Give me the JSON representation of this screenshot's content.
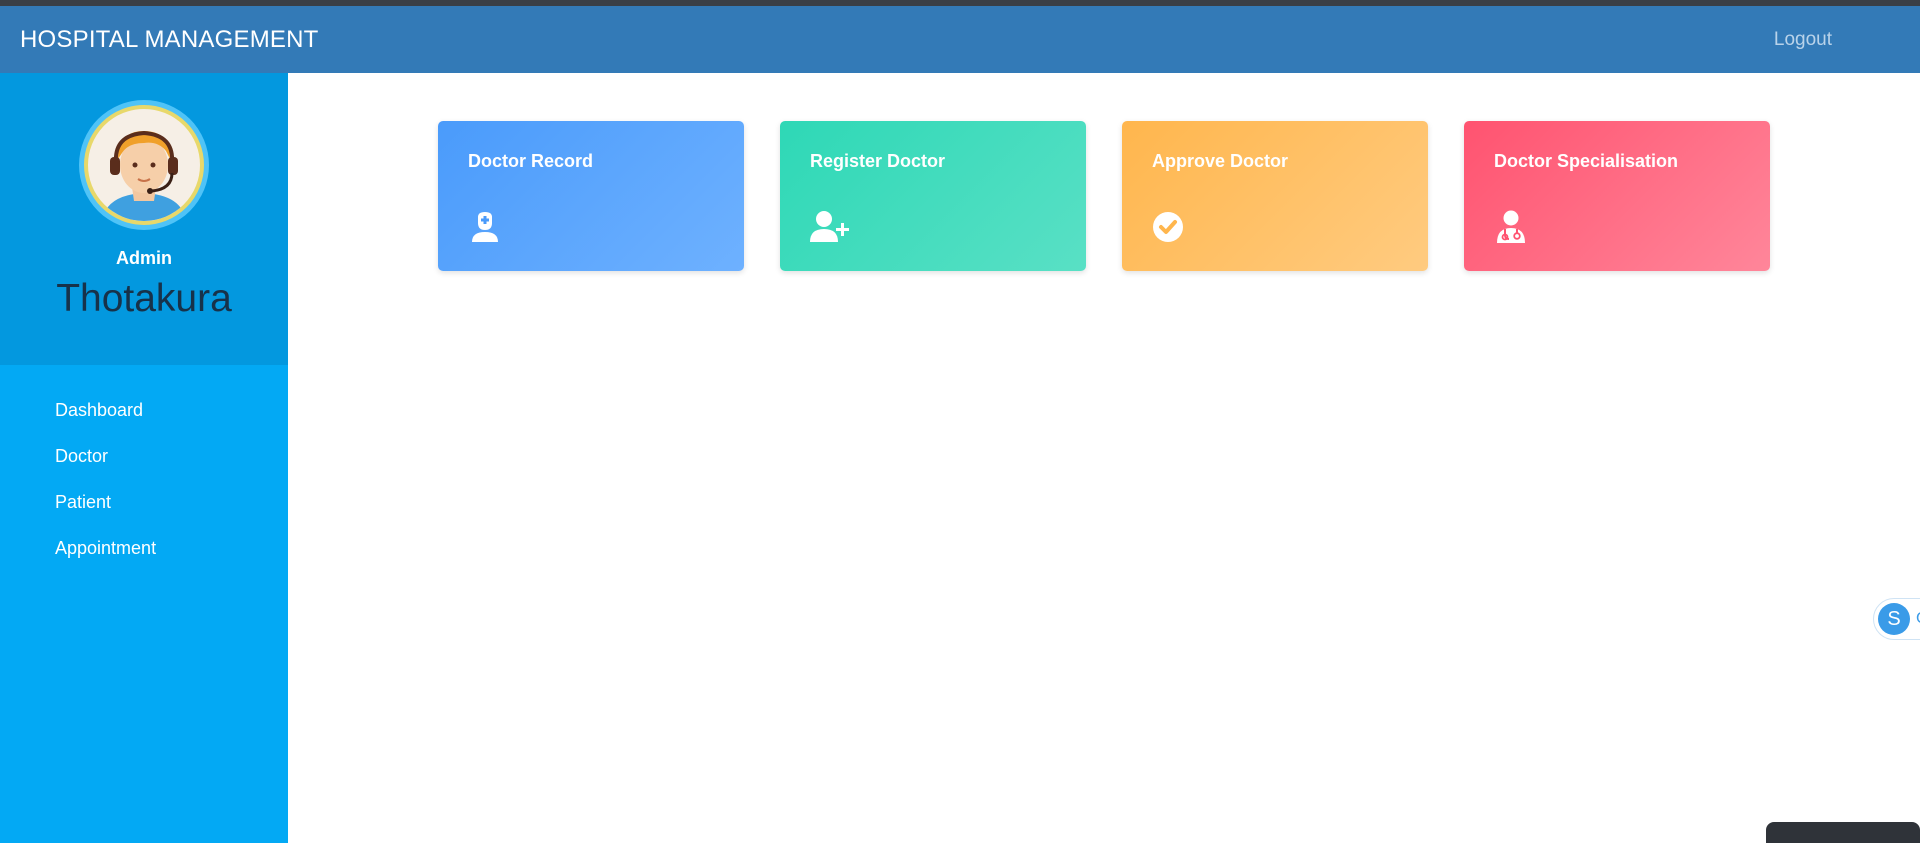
{
  "navbar": {
    "brand": "HOSPITAL MANAGEMENT",
    "logout": "Logout"
  },
  "sidebar": {
    "role": "Admin",
    "name": "Thotakura",
    "items": [
      {
        "label": "Dashboard"
      },
      {
        "label": "Doctor"
      },
      {
        "label": "Patient"
      },
      {
        "label": "Appointment"
      }
    ]
  },
  "cards": [
    {
      "title": "Doctor Record",
      "icon": "user-doctor-icon",
      "color": "#4a9bfb"
    },
    {
      "title": "Register Doctor",
      "icon": "user-plus-icon",
      "color": "#2ed8b6"
    },
    {
      "title": "Approve Doctor",
      "icon": "check-circle-icon",
      "color": "#ffb64d"
    },
    {
      "title": "Doctor Specialisation",
      "icon": "doctor-stethoscope-icon",
      "color": "#ff5370"
    }
  ],
  "colors": {
    "navbar": "#337ab7",
    "sidebar": "#03a9f4",
    "profile": "#0398df"
  },
  "widgets": {
    "skype_initial": "S",
    "skype_edge": "C"
  }
}
